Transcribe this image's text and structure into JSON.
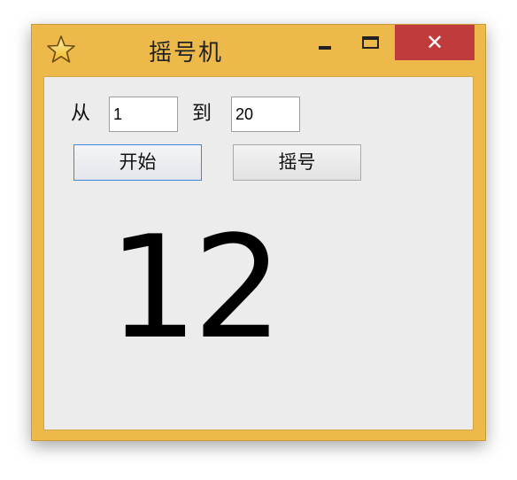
{
  "window": {
    "title": "摇号机",
    "icon": "star-icon",
    "controls": {
      "minimize_icon": "minimize-icon",
      "maximize_icon": "maximize-icon",
      "close_glyph": "✕"
    },
    "accent_color": "#edb94b",
    "close_color": "#c03b3b"
  },
  "range": {
    "from_label": "从",
    "from_value": "1",
    "to_label": "到",
    "to_value": "20"
  },
  "buttons": {
    "start_label": "开始",
    "draw_label": "摇号"
  },
  "result": {
    "number": "12"
  }
}
